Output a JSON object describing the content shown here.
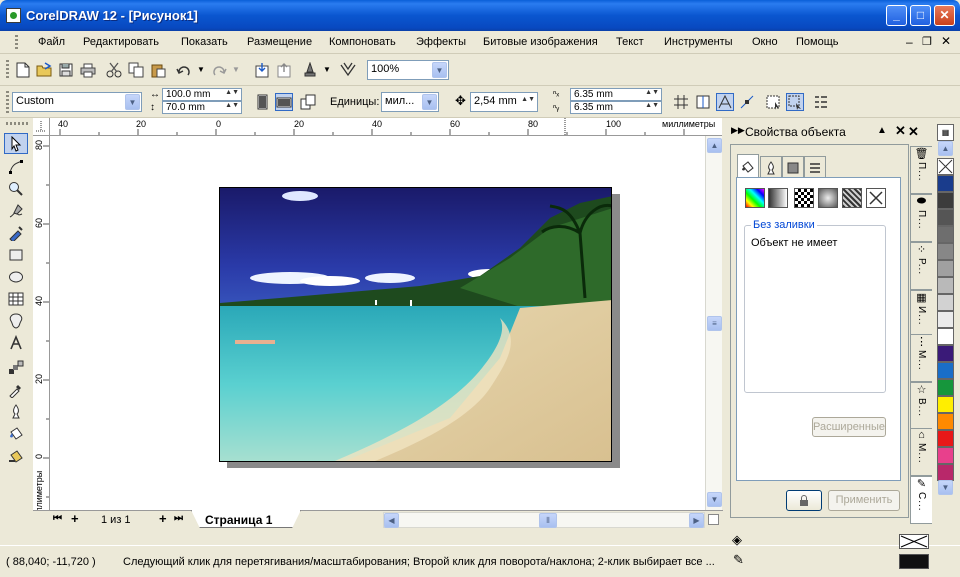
{
  "window": {
    "title": "CorelDRAW 12 - [Рисунок1]"
  },
  "menu": {
    "items": [
      "Файл",
      "Редактировать",
      "Показать",
      "Размещение",
      "Компоновать",
      "Эффекты",
      "Битовые изображения",
      "Текст",
      "Инструменты",
      "Окно",
      "Помощь"
    ]
  },
  "toolbar": {
    "zoom": "100%"
  },
  "propbar": {
    "preset": "Custom",
    "width": "100.0 mm",
    "height": "70.0 mm",
    "units_label": "Единицы:",
    "units_value": "мил...",
    "nudge": "2,54 mm",
    "dup_x": "6.35 mm",
    "dup_y": "6.35 mm"
  },
  "ruler": {
    "units": "миллиметры",
    "h_ticks": [
      "40",
      "20",
      "0",
      "20",
      "40",
      "60",
      "80",
      "100"
    ],
    "v_ticks": [
      "80",
      "60",
      "40",
      "20",
      "0"
    ]
  },
  "pages": {
    "counter": "1 из 1",
    "tab": "Страница 1"
  },
  "docker": {
    "title": "Свойства объекта",
    "fill_group": "Без заливки",
    "fill_text": "Объект не имеет",
    "advanced_button": "Расширенные",
    "apply_button": "Применить"
  },
  "side_tabs": [
    "П...",
    "П...",
    "Р...",
    "И...",
    "М...",
    "В...",
    "М...",
    "С..."
  ],
  "palette": {
    "colors": [
      "#ffffff",
      "#000000",
      "#1a3c8c",
      "#3c3c3c",
      "#555555",
      "#6e6e6e",
      "#878787",
      "#a0a0a0",
      "#b9b9b9",
      "#d2d2d2",
      "#ebebeb",
      "#ffffff",
      "#3a1a78",
      "#1a6ec8",
      "#16963c",
      "#ffee00",
      "#ff8a00",
      "#e81818",
      "#e8408c",
      "#b8286a"
    ]
  },
  "status": {
    "coords": "( 88,040; -11,720 )",
    "message": "Следующий клик для перетягивания/масштабирования; Второй клик для поворота/наклона; 2-клик выбирает все ..."
  }
}
